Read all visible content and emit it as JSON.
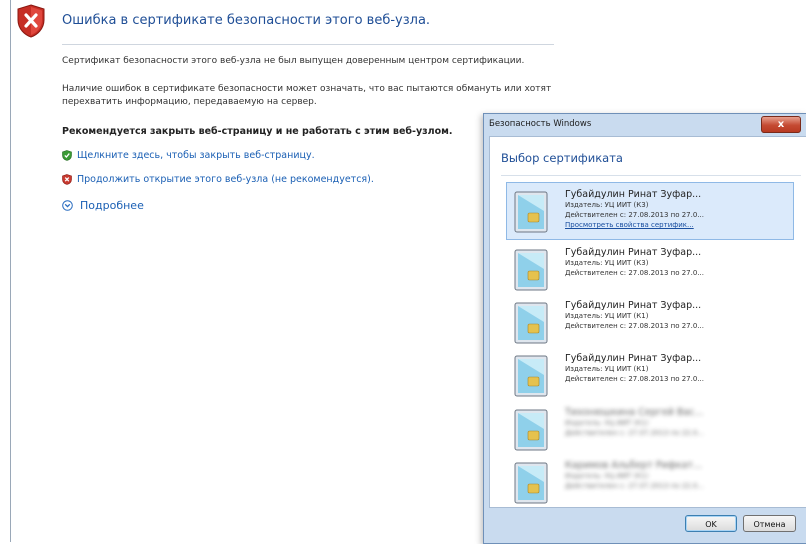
{
  "page": {
    "title": "Ошибка в сертификате безопасности этого веб-узла.",
    "p1": "Сертификат безопасности этого веб-узла не был выпущен доверенным центром сертификации.",
    "p2": "Наличие ошибок в сертификате безопасности может означать, что вас пытаются обмануть или хотят перехватить информацию, передаваемую на сервер.",
    "recommend": "Рекомендуется закрыть веб-страницу и не работать с этим веб-узлом.",
    "close_link": "Щелкните здесь, чтобы закрыть веб-страницу.",
    "continue_link": "Продолжить открытие этого веб-узла (не рекомендуется).",
    "more": "Подробнее"
  },
  "dialog": {
    "title": "Безопасность Windows",
    "close_label": "x",
    "heading": "Выбор сертификата",
    "certificates": [
      {
        "name": "Губайдулин Ринат  Зуфар...",
        "issuer": "Издатель: УЦ ИИТ (К3)",
        "valid": "Действителен с: 27.08.2013 по 27.0...",
        "link": "Просмотреть свойства сертифик..."
      },
      {
        "name": "Губайдулин Ринат  Зуфар...",
        "issuer": "Издатель: УЦ ИИТ (К3)",
        "valid": "Действителен с: 27.08.2013 по 27.0..."
      },
      {
        "name": "Губайдулин Ринат  Зуфар...",
        "issuer": "Издатель: УЦ ИИТ (К1)",
        "valid": "Действителен с: 27.08.2013 по 27.0..."
      },
      {
        "name": "Губайдулин Ринат  Зуфар...",
        "issuer": "Издатель: УЦ ИИТ (К1)",
        "valid": "Действителен с: 27.08.2013 по 27.0..."
      },
      {
        "name": "Тихонюшкина Сергей Вас...",
        "issuer": "Издатель: УЦ ИИТ (К1)",
        "valid": "Действителен с: 27.07.2013 по 22.0..."
      },
      {
        "name": "Каримов Альберт Рифкат...",
        "issuer": "Издатель: УЦ ИИТ (К1)",
        "valid": "Действителен с: 27.07.2013 по 22.0..."
      }
    ],
    "ok": "OK",
    "cancel": "Отмена"
  }
}
